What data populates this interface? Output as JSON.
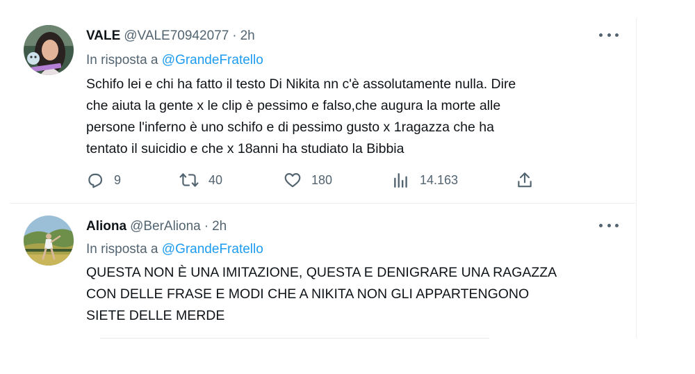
{
  "tweets": [
    {
      "name": "VALE",
      "handle": "@VALE70942077",
      "separator": "·",
      "time": "2h",
      "reply_prefix": "In risposta a",
      "reply_mention": "@GrandeFratello",
      "body_lines": [
        "Schifo lei e chi ha fatto il testo Di Nikita nn c'è assolutamente nulla. Dire",
        "che aiuta la gente x le clip è pessimo e falso,che augura la morte alle",
        "persone l'inferno è uno schifo e di pessimo gusto x 1ragazza che ha",
        "tentato il suicidio e che x 18anni ha studiato la Bibbia"
      ],
      "stats": {
        "replies": "9",
        "retweets": "40",
        "likes": "180",
        "views": "14.163"
      },
      "icons": {
        "reply": "reply-icon",
        "retweet": "retweet-icon",
        "like": "heart-icon",
        "views": "views-chart-icon",
        "share": "share-icon",
        "more": "more-dots-icon"
      }
    },
    {
      "name": "Aliona",
      "handle": "@BerAliona",
      "separator": "·",
      "time": "2h",
      "reply_prefix": "In risposta a",
      "reply_mention": "@GrandeFratello",
      "body_lines": [
        "QUESTA NON È UNA IMITAZIONE, QUESTA E DENIGRARE UNA RAGAZZA",
        "CON DELLE FRASE E MODI CHE A NIKITA NON GLI APPARTENGONO",
        "SIETE DELLE MERDE"
      ],
      "icons": {
        "more": "more-dots-icon"
      }
    }
  ],
  "colors": {
    "text": "#0f1419",
    "secondary": "#536471",
    "link": "#1d9bf0",
    "divider": "#eceff1"
  }
}
